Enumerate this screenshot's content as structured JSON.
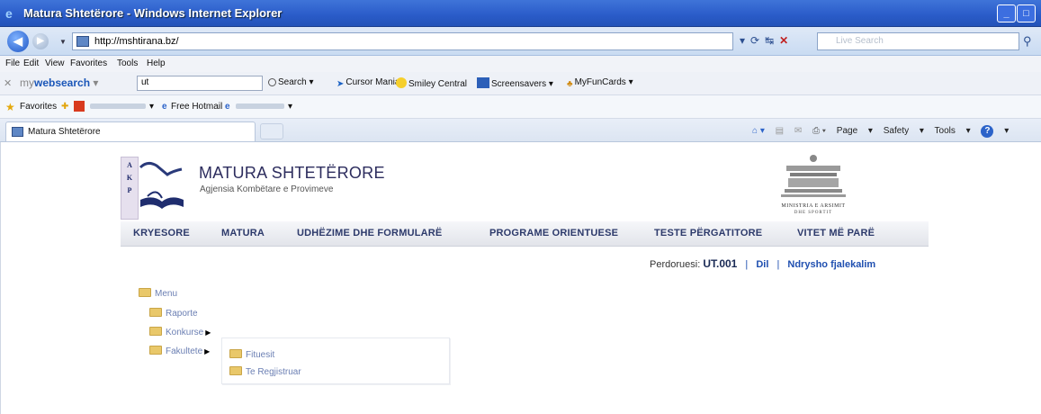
{
  "window": {
    "title": "Matura Shtetërore - Windows Internet Explorer"
  },
  "address": {
    "url": "http://mshtirana.bz/",
    "search_placeholder": "Live Search"
  },
  "menubar": [
    "File",
    "Edit",
    "View",
    "Favorites",
    "Tools",
    "Help"
  ],
  "toolbar": {
    "brand_prefix": "my",
    "brand_main": "websearch",
    "search_value": "ut",
    "items": [
      "Search",
      "Cursor Mania",
      "Smiley Central",
      "Screensavers",
      "MyFunCards"
    ]
  },
  "favorites": {
    "label": "Favorites",
    "hotmail": "Free Hotmail"
  },
  "tab": {
    "title": "Matura Shtetërore"
  },
  "commands": [
    "Page",
    "Safety",
    "Tools"
  ],
  "site": {
    "title": "MATURA SHTETËRORE",
    "subtitle": "Agjensia Kombëtare e Provimeve",
    "logo_letters": [
      "A",
      "K",
      "P"
    ],
    "ministry_line1": "MINISTRIA E ARSIMIT",
    "ministry_line2": "DHE SPORTIT",
    "nav": [
      "KRYESORE",
      "MATURA",
      "UDHËZIME DHE FORMULARË",
      "PROGRAME ORIENTUESE",
      "TESTE PËRGATITORE",
      "VITET MË PARË"
    ],
    "user_label": "Perdoruesi:",
    "user_id": "UT.001",
    "logout": "Dil",
    "change_password": "Ndrysho fjalekalim"
  },
  "tree": {
    "root": "Menu",
    "items": [
      "Raporte",
      "Konkurse",
      "Fakultete"
    ],
    "submenu": [
      "Fituesit",
      "Te Regjistruar"
    ]
  }
}
